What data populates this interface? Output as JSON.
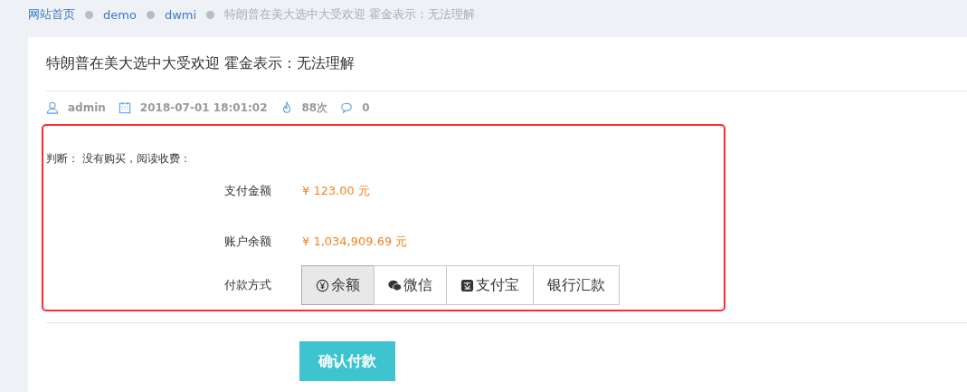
{
  "breadcrumb": [
    {
      "label": "网站首页",
      "link": true
    },
    {
      "label": "demo",
      "link": true
    },
    {
      "label": "dwmi",
      "link": true
    },
    {
      "label": "特朗普在美大选中大受欢迎 霍金表示：无法理解",
      "link": false
    }
  ],
  "article": {
    "title": "特朗普在美大选中大受欢迎 霍金表示：无法理解",
    "author": "admin",
    "date": "2018-07-01 18:01:02",
    "views": "88次",
    "comments": "0"
  },
  "payment": {
    "notice": "判断：  没有购买，阅读收费：",
    "rows": [
      {
        "label": "支付金额",
        "value": "¥ 123.00 元"
      },
      {
        "label": "账户余额",
        "value": "¥ 1,034,909.69 元"
      }
    ],
    "method_label": "付款方式",
    "methods": [
      {
        "label": "余额",
        "kind": "balance",
        "selected": true
      },
      {
        "label": "微信",
        "kind": "wechat",
        "selected": false
      },
      {
        "label": "支付宝",
        "kind": "alipay",
        "selected": false
      },
      {
        "label": "银行汇款",
        "kind": "bank",
        "selected": false
      }
    ],
    "confirm": "确认付款"
  }
}
